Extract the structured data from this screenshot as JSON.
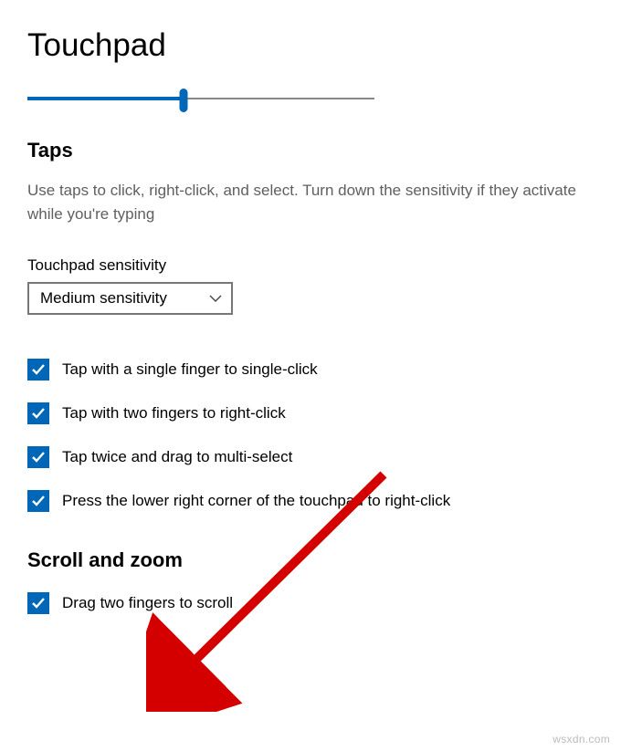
{
  "title": "Touchpad",
  "slider": {
    "percent": 45
  },
  "taps": {
    "heading": "Taps",
    "description": "Use taps to click, right-click, and select. Turn down the sensitivity if they activate while you're typing",
    "sensitivity": {
      "label": "Touchpad sensitivity",
      "value": "Medium sensitivity"
    },
    "options": [
      {
        "label": "Tap with a single finger to single-click",
        "checked": true
      },
      {
        "label": "Tap with two fingers to right-click",
        "checked": true
      },
      {
        "label": "Tap twice and drag to multi-select",
        "checked": true
      },
      {
        "label": "Press the lower right corner of the touchpad to right-click",
        "checked": true
      }
    ]
  },
  "scrollzoom": {
    "heading": "Scroll and zoom",
    "options": [
      {
        "label": "Drag two fingers to scroll",
        "checked": true
      }
    ]
  },
  "watermark": "wsxdn.com",
  "colors": {
    "accent": "#0067b8"
  }
}
